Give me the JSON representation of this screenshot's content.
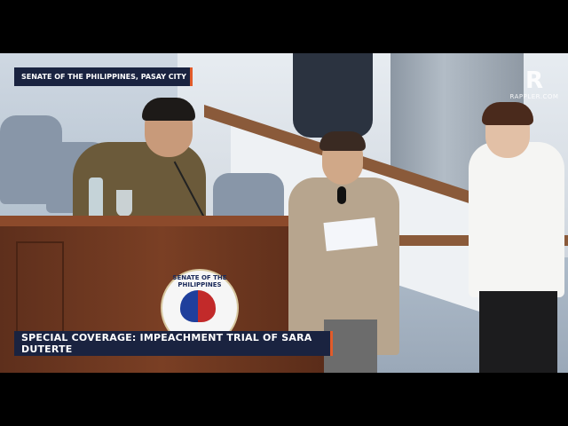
{
  "overlay": {
    "location": "SENATE OF THE PHILIPPINES, PASAY CITY",
    "coverage": "SPECIAL COVERAGE: IMPEACHMENT TRIAL OF SARA DUTERTE"
  },
  "watermark": {
    "mark": "R",
    "text": "RAPPLER.COM"
  },
  "seal": {
    "text": "SENATE OF THE PHILIPPINES"
  },
  "colors": {
    "bar_bg": "#1a2340",
    "bar_accent": "#e25b2a"
  }
}
